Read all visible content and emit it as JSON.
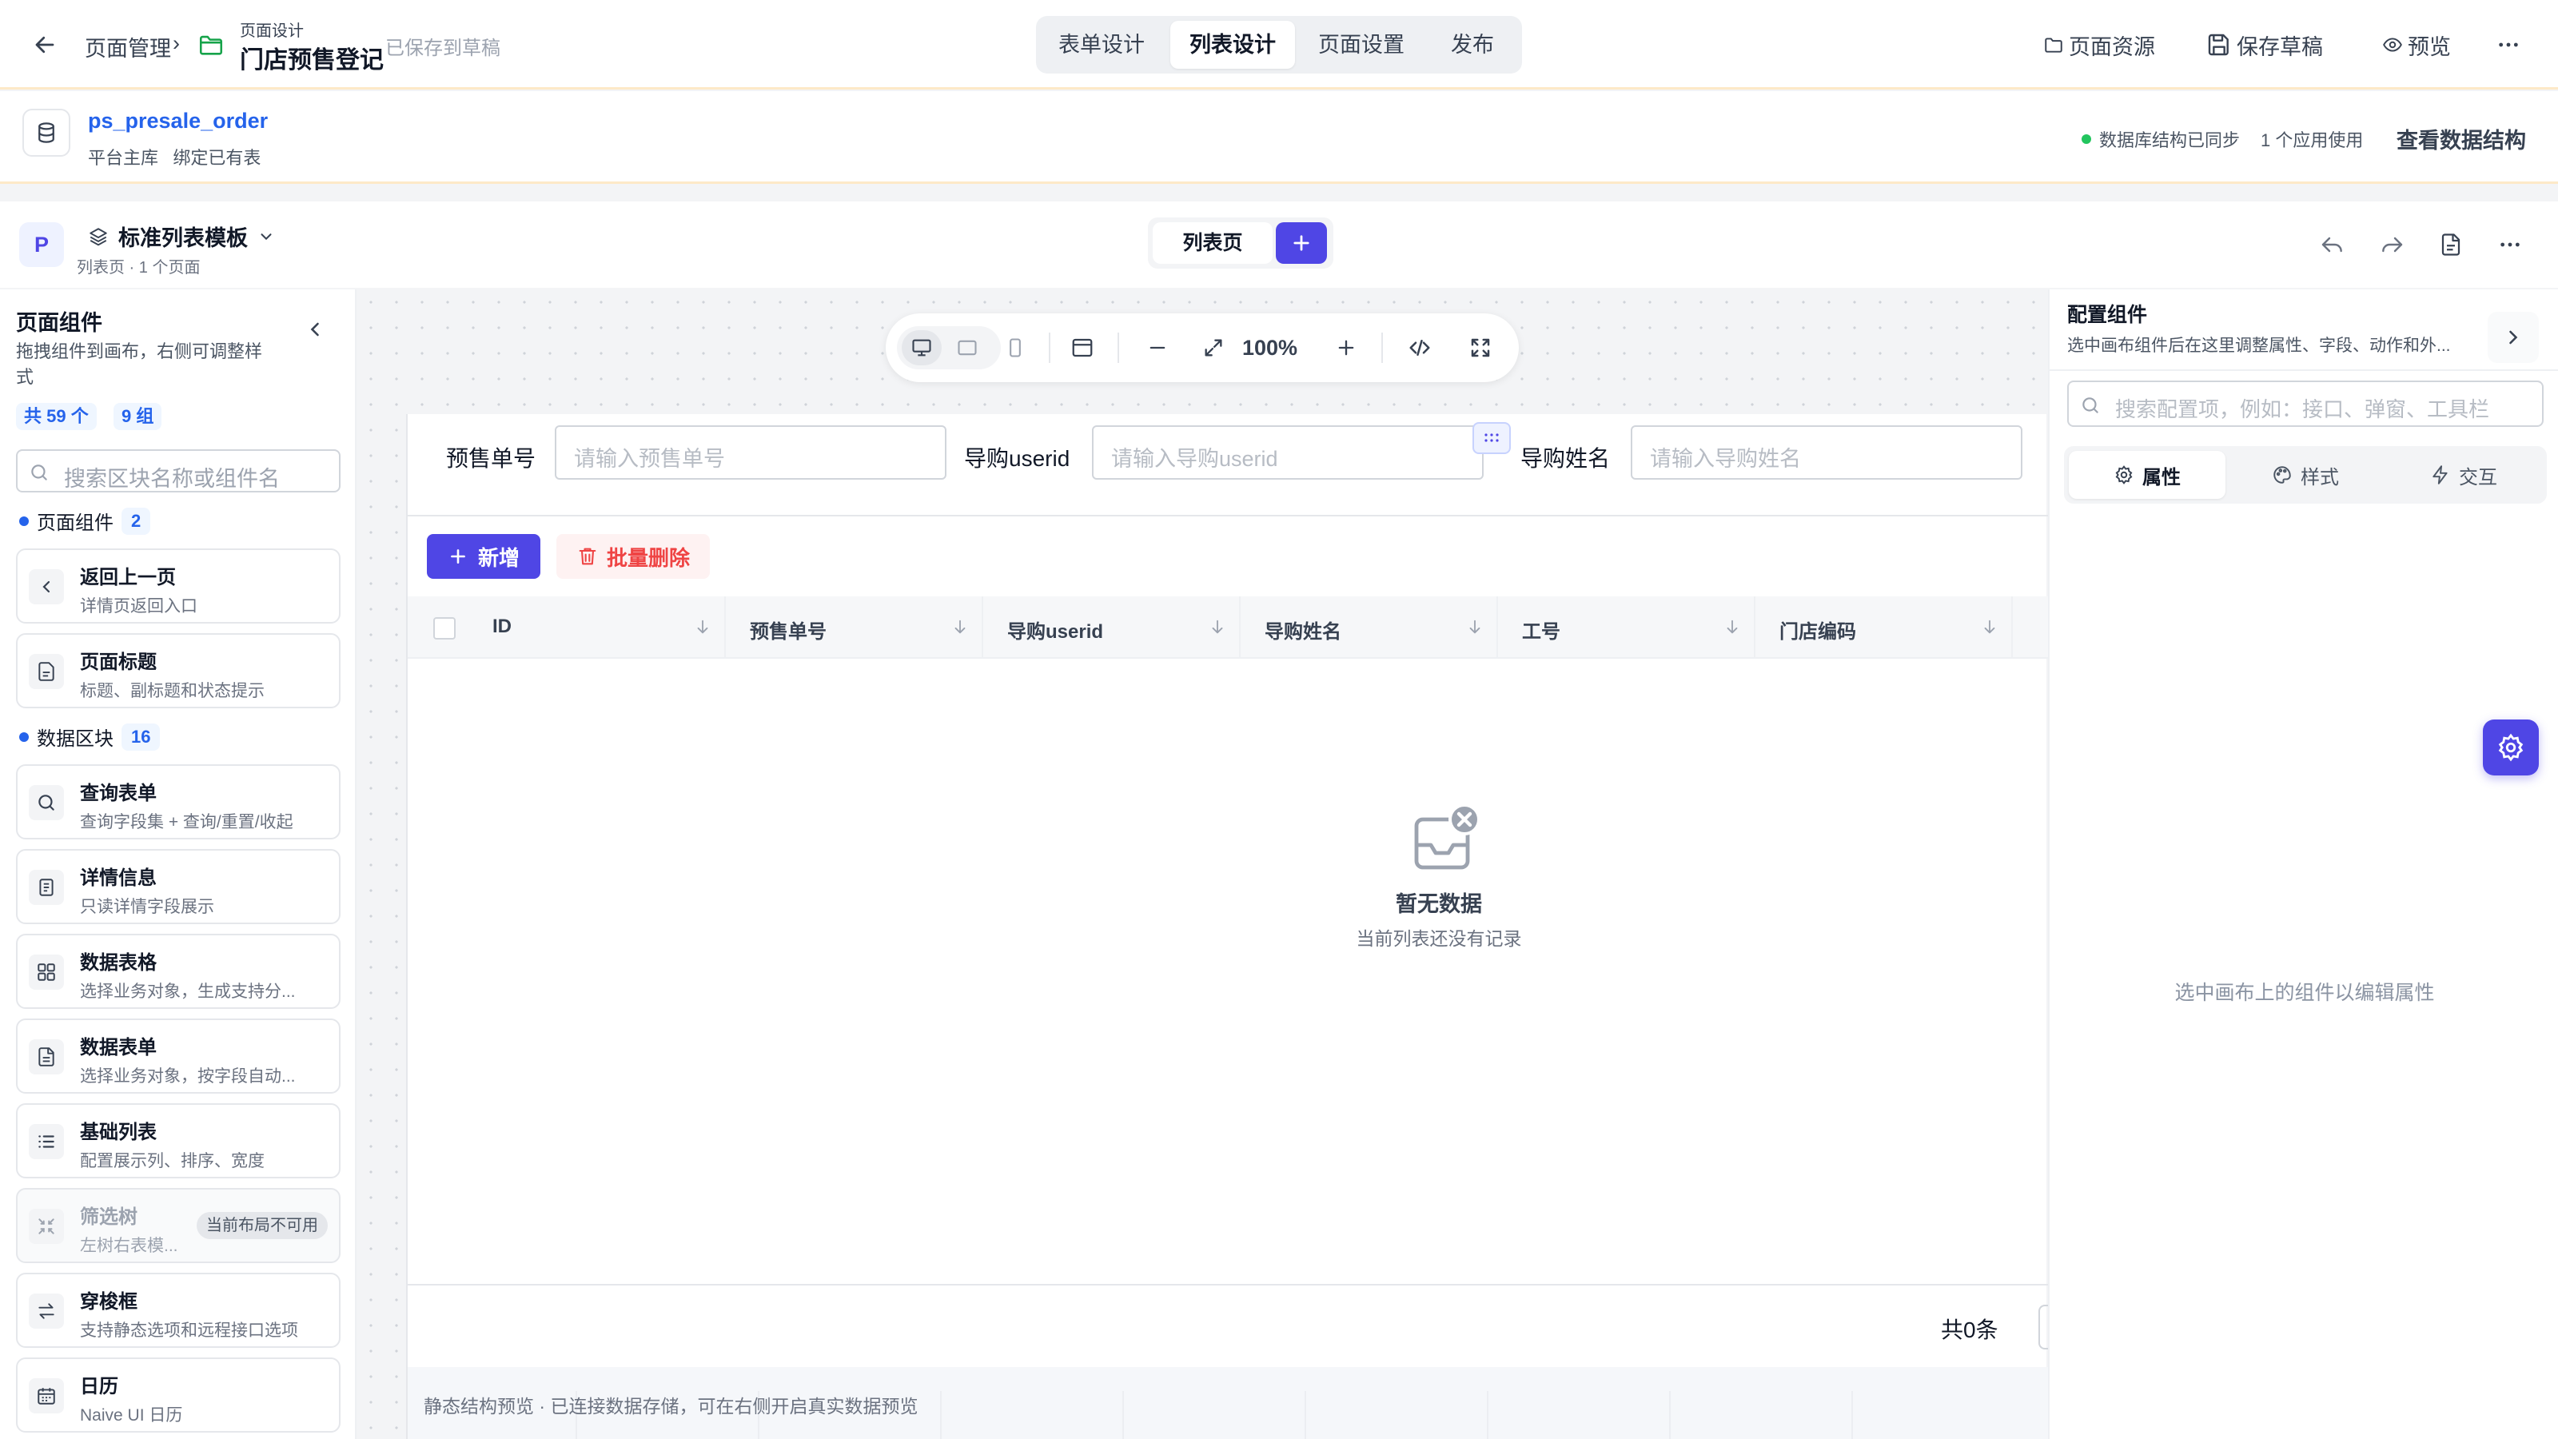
{
  "topbar": {
    "breadcrumb_root": "页面管理",
    "breadcrumb_sep": "›",
    "page_type": "页面设计",
    "page_title": "门店预售登记",
    "save_status": "已保存到草稿",
    "tabs": [
      {
        "label": "表单设计",
        "active": false
      },
      {
        "label": "列表设计",
        "active": true
      },
      {
        "label": "页面设置",
        "active": false
      },
      {
        "label": "发布",
        "active": false
      }
    ],
    "actions": {
      "resources": "页面资源",
      "save_draft": "保存草稿",
      "preview": "预览"
    }
  },
  "table_bar": {
    "table_name": "ps_presale_order",
    "table_sub": "平台主库   绑定已有表",
    "sync_status": "数据库结构已同步",
    "app_usage": "1 个应用使用",
    "view_structure": "查看数据结构",
    "sync_color": "#22c55e"
  },
  "template_bar": {
    "badge": "P",
    "template_name": "标准列表模板",
    "template_sub": "列表页 · 1 个页面",
    "page_tab": "列表页"
  },
  "left_panel": {
    "title": "页面组件",
    "desc": "拖拽组件到画布，右侧可调整样式",
    "total_badge": "共 59 个",
    "group_badge": "9 组",
    "search_placeholder": "搜索区块名称或组件名",
    "groups": [
      {
        "name": "页面组件",
        "count": "2"
      },
      {
        "name": "数据区块",
        "count": "16"
      }
    ],
    "components": [
      {
        "icon": "chevron-left-icon",
        "title": "返回上一页",
        "desc": "详情页返回入口"
      },
      {
        "icon": "document-icon",
        "title": "页面标题",
        "desc": "标题、副标题和状态提示"
      },
      {
        "icon": "search-icon",
        "title": "查询表单",
        "desc": "查询字段集 + 查询/重置/收起"
      },
      {
        "icon": "info-doc-icon",
        "title": "详情信息",
        "desc": "只读详情字段展示"
      },
      {
        "icon": "grid-icon",
        "title": "数据表格",
        "desc": "选择业务对象，生成支持分..."
      },
      {
        "icon": "form-doc-icon",
        "title": "数据表单",
        "desc": "选择业务对象，按字段自动..."
      },
      {
        "icon": "list-icon",
        "title": "基础列表",
        "desc": "配置展示列、排序、宽度"
      },
      {
        "icon": "tree-icon",
        "title": "筛选树",
        "desc": "左树右表模...",
        "tag": "当前布局不可用",
        "disabled": true
      },
      {
        "icon": "transfer-icon",
        "title": "穿梭框",
        "desc": "支持静态选项和远程接口选项"
      },
      {
        "icon": "calendar-icon",
        "title": "日历",
        "desc": "Naive UI 日历"
      }
    ]
  },
  "canvas": {
    "zoom": "100%",
    "filters": [
      {
        "label": "预售单号",
        "placeholder": "请输入预售单号"
      },
      {
        "label": "导购userid",
        "placeholder": "请输入导购userid"
      },
      {
        "label": "导购姓名",
        "placeholder": "请输入导购姓名"
      }
    ],
    "btn_add": "新增",
    "btn_batch_delete": "批量删除",
    "columns": [
      "ID",
      "预售单号",
      "导购userid",
      "导购姓名",
      "工号",
      "门店编码"
    ],
    "empty_title": "暂无数据",
    "empty_desc": "当前列表还没有记录",
    "total": "共0条",
    "preview_note": "静态结构预览 · 已连接数据存储，可在右侧开启真实数据预览",
    "accent": "#4f46e5",
    "danger": "#ef4444"
  },
  "right_panel": {
    "title": "配置组件",
    "desc": "选中画布组件后在这里调整属性、字段、动作和外...",
    "search_placeholder": "搜索配置项，例如：接口、弹窗、工具栏",
    "tabs": [
      {
        "icon": "gear-icon",
        "label": "属性",
        "active": true
      },
      {
        "icon": "palette-icon",
        "label": "样式",
        "active": false
      },
      {
        "icon": "bolt-icon",
        "label": "交互",
        "active": false
      }
    ],
    "empty_hint": "选中画布上的组件以编辑属性"
  }
}
